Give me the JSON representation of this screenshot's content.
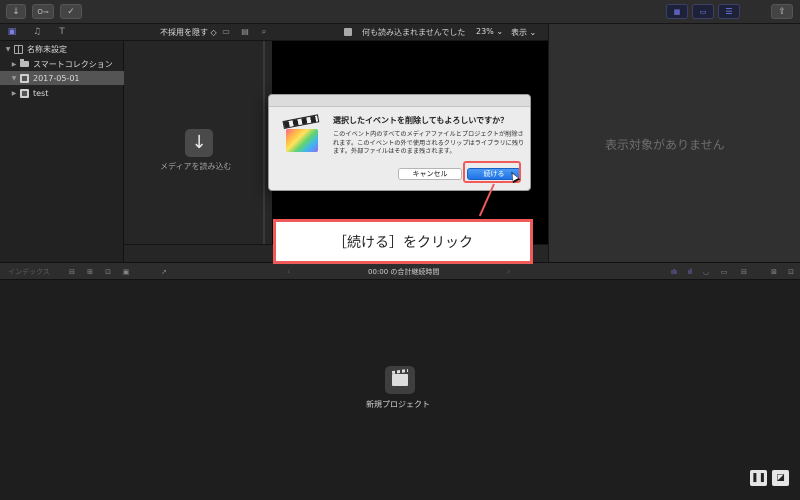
{
  "library": {
    "name": "名称未設定",
    "items": [
      {
        "label": "スマートコレクション"
      },
      {
        "label": "2017-05-01"
      },
      {
        "label": "test"
      }
    ]
  },
  "browser": {
    "filter_label": "不採用を隠す",
    "import_label": "メディアを読み込む"
  },
  "viewer": {
    "status_text": "何も読み込まれませんでした",
    "zoom": "23%",
    "display_menu": "表示"
  },
  "inspector": {
    "empty_text": "表示対象がありません"
  },
  "timeline": {
    "index_label": "インデックス",
    "duration_text": "00:00 の合計継続時間",
    "new_project_label": "新規プロジェクト"
  },
  "dialog": {
    "title": "選択したイベントを削除してもよろしいですか？",
    "body": "このイベント内のすべてのメディアファイルとプロジェクトが削除されます。このイベントの外で使用されるクリップはライブラリに残ります。外部ファイルはそのまま残されます。",
    "cancel_label": "キャンセル",
    "continue_label": "続ける"
  },
  "annotation": {
    "callout_text": "［続ける］をクリック",
    "color": "#f05a59"
  }
}
